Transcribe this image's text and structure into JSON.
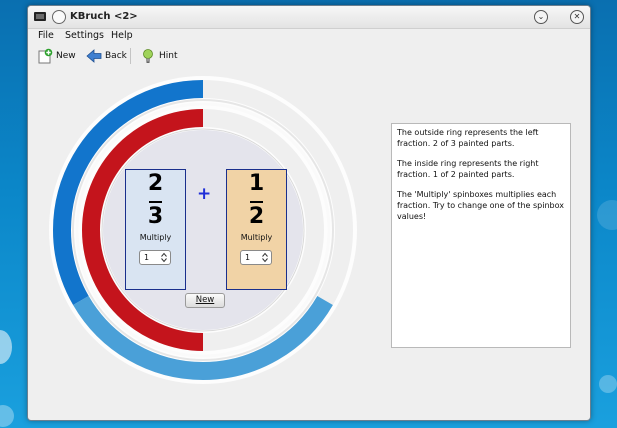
{
  "window": {
    "title": "KBruch <2>"
  },
  "menu": {
    "file": "File",
    "settings": "Settings",
    "help": "Help"
  },
  "toolbar": {
    "new_label": "New",
    "back_label": "Back",
    "hint_label": "Hint"
  },
  "exercise": {
    "left": {
      "numerator": "2",
      "denominator": "3",
      "multiply_label": "Multiply",
      "multiply_value": "1"
    },
    "operator": "+",
    "right": {
      "numerator": "1",
      "denominator": "2",
      "multiply_label": "Multiply",
      "multiply_value": "1"
    },
    "new_button": "New"
  },
  "info": {
    "p1": "The outside ring represents the left fraction. 2 of 3 painted parts.",
    "p2": "The inside ring represents the right fraction. 1 of 2 painted parts.",
    "p3": "The 'Multiply' spinboxes multiplies each fraction. Try to change one of the spinbox values!"
  },
  "rings": {
    "outer": {
      "parts": 3,
      "painted": 2,
      "colors": [
        "#1275cc",
        "#4aa0d8"
      ]
    },
    "inner": {
      "parts": 2,
      "painted": 1,
      "color": "#c4141c"
    },
    "unpainted_color": "#efefef"
  },
  "colors": {
    "left_box": "#d9e4f2",
    "right_box": "#f1d3a6",
    "box_border": "#1a2f8c",
    "plus": "#1f2ed8"
  }
}
